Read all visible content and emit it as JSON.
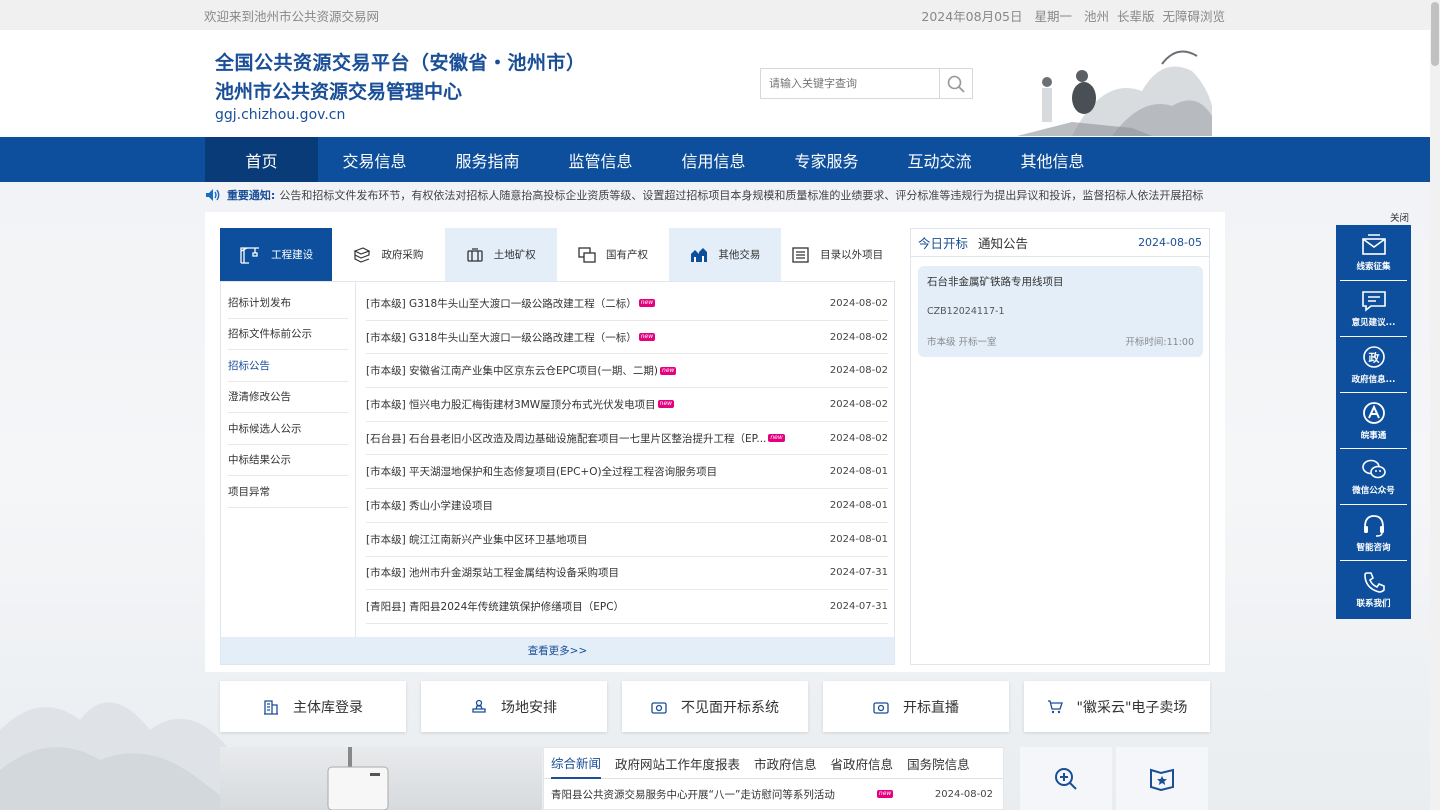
{
  "topbar": {
    "welcome": "欢迎来到池州市公共资源交易网",
    "date": "2024年08月05日",
    "weekday": "星期一",
    "city": "池州",
    "elder": "长辈版",
    "accessible": "无障碍浏览"
  },
  "header": {
    "title1": "全国公共资源交易平台（安徽省・池州市）",
    "title2": "池州市公共资源交易管理中心",
    "domain": "ggj.chizhou.gov.cn",
    "search_placeholder": "请输入关键字查询"
  },
  "nav": [
    "首页",
    "交易信息",
    "服务指南",
    "监管信息",
    "信用信息",
    "专家服务",
    "互动交流",
    "其他信息"
  ],
  "notice": {
    "label": "重要通知:",
    "text": "公告和招标文件发布环节，有权依法对招标人随意抬高投标企业资质等级、设置超过招标项目本身规模和质量标准的业绩要求、评分标准等违规行为提出异议和投诉，监督招标人依法开展招标"
  },
  "tabs": [
    "工程建设",
    "政府采购",
    "土地矿权",
    "国有产权",
    "其他交易",
    "目录以外项目"
  ],
  "subnav": [
    "招标计划发布",
    "招标文件标前公示",
    "招标公告",
    "澄清修改公告",
    "中标候选人公示",
    "中标结果公示",
    "项目异常"
  ],
  "list": [
    {
      "title": "[市本级] G318牛头山至大渡口一级公路改建工程（二标）",
      "date": "2024-08-02",
      "new": "new"
    },
    {
      "title": "[市本级] G318牛头山至大渡口一级公路改建工程（一标）",
      "date": "2024-08-02",
      "new": "new"
    },
    {
      "title": "[市本级] 安徽省江南产业集中区京东云仓EPC项目(一期、二期)",
      "date": "2024-08-02",
      "new": "new"
    },
    {
      "title": "[市本级] 恒兴电力股汇梅街建材3MW屋顶分布式光伏发电项目",
      "date": "2024-08-02",
      "new": "new"
    },
    {
      "title": "[石台县] 石台县老旧小区改造及周边基础设施配套项目一七里片区整治提升工程（EP...",
      "date": "2024-08-02",
      "new": "new"
    },
    {
      "title": "[市本级] 平天湖湿地保护和生态修复项目(EPC+O)全过程工程咨询服务项目",
      "date": "2024-08-01",
      "new": ""
    },
    {
      "title": "[市本级] 秀山小学建设项目",
      "date": "2024-08-01",
      "new": ""
    },
    {
      "title": "[市本级] 皖江江南新兴产业集中区环卫基地项目",
      "date": "2024-08-01",
      "new": ""
    },
    {
      "title": "[市本级] 池州市升金湖泵站工程金属结构设备采购项目",
      "date": "2024-07-31",
      "new": ""
    },
    {
      "title": "[青阳县] 青阳县2024年传统建筑保护修缮项目（EPC）",
      "date": "2024-07-31",
      "new": ""
    }
  ],
  "more": "查看更多>>",
  "side": {
    "tabs": [
      "今日开标",
      "通知公告"
    ],
    "date": "2024-08-05",
    "card": {
      "name": "石台非金属矿铁路专用线项目",
      "code": "CZB12024117-1",
      "place": "市本级 开标一室",
      "time": "开标时间:11:00"
    }
  },
  "quick": [
    "主体库登录",
    "场地安排",
    "不见面开标系统",
    "开标直播",
    "\"徽采云\"电子卖场"
  ],
  "news": {
    "tabs": [
      "综合新闻",
      "政府网站工作年度报表",
      "市政府信息",
      "省政府信息",
      "国务院信息"
    ],
    "items": [
      {
        "title": "青阳县公共资源交易服务中心开展“八一”走访慰问等系列活动",
        "date": "2024-08-02",
        "new": "new"
      }
    ]
  },
  "floatbar": {
    "close": "关闭",
    "items": [
      "线索征集",
      "意见建议...",
      "政府信息...",
      "皖事通",
      "微信公众号",
      "智能咨询",
      "联系我们"
    ]
  },
  "colors": {
    "primary": "#0d4f9c",
    "nav_active": "#083b78",
    "light": "#e3eef9",
    "badge": "#e4007f"
  }
}
